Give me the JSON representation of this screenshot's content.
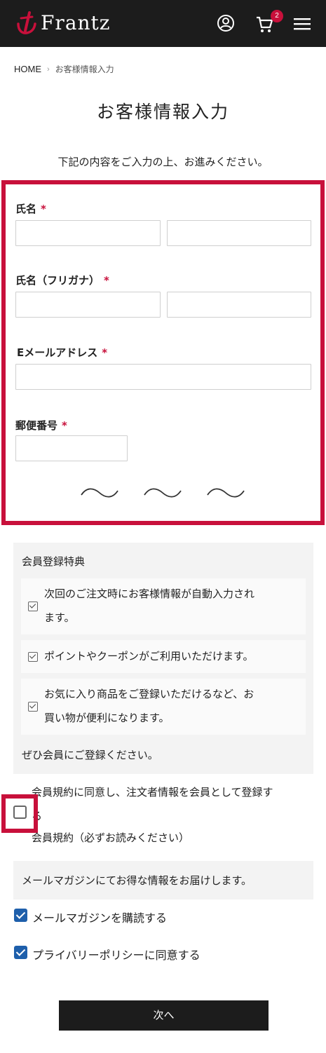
{
  "header": {
    "logo_text": "Frantz",
    "cart_count": "2",
    "icons": [
      "logo-mark-icon",
      "user-icon",
      "cart-icon",
      "menu-icon"
    ]
  },
  "breadcrumb": {
    "home": "HOME",
    "separator": "›",
    "current": "お客様情報入力"
  },
  "page": {
    "title": "お客様情報入力",
    "intro": "下記の内容をご入力の上、お進みください。"
  },
  "form": {
    "name_label": "氏名",
    "kana_label": "氏名（フリガナ）",
    "email_label": "Eメールアドレス",
    "postal_label": "郵便番号",
    "required_mark": "*"
  },
  "benefits": {
    "title": "会員登録特典",
    "items": [
      {
        "line1": "次回のご注文時にお客様情報が自動入力され",
        "line2": "ます。"
      },
      {
        "line1": "ポイントやクーポンがご利用いただけます。"
      },
      {
        "line1": "お気に入り商品をご登録いただけるなど、お",
        "line2": "買い物が便利になります。"
      }
    ],
    "footer": "ぜひ会員にご登録ください。"
  },
  "membership": {
    "agree_line1": "会員規約に同意し、注文者情報を会員として登録す",
    "agree_line2": "る",
    "terms_link": "会員規約（必ずお読みください）",
    "checked": false
  },
  "newsletter": {
    "info": "メールマガジンにてお得な情報をお届けします。",
    "subscribe_label": "メールマガジンを購読する",
    "subscribe_checked": true,
    "privacy_label": "プライバリーポリシーに同意する",
    "privacy_checked": true
  },
  "actions": {
    "next_label": "次へ"
  },
  "colors": {
    "header_bg": "#1c1c1c",
    "accent_red": "#c8103b",
    "checkbox_blue": "#1e5fab",
    "panel_bg": "#f3f3f3"
  }
}
